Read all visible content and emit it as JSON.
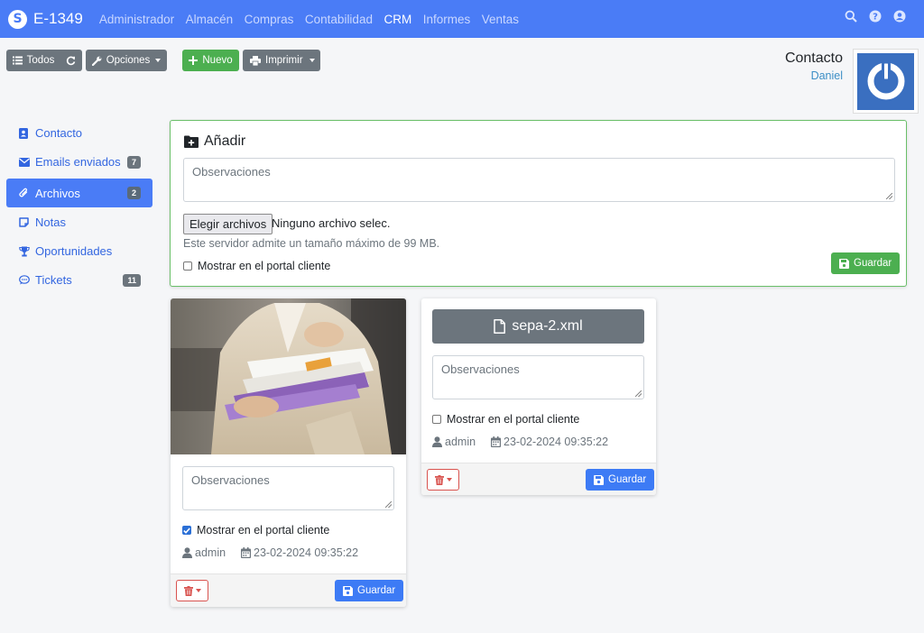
{
  "navbar": {
    "brand": "E-1349",
    "links": [
      "Administrador",
      "Almacén",
      "Compras",
      "Contabilidad",
      "CRM",
      "Informes",
      "Ventas"
    ],
    "active": "CRM",
    "icons": [
      "search-icon",
      "help-icon",
      "user-icon"
    ]
  },
  "toolbar": {
    "todos_label": "Todos",
    "opciones_label": "Opciones",
    "nuevo_label": "Nuevo",
    "imprimir_label": "Imprimir"
  },
  "contact": {
    "title": "Contacto",
    "name": "Daniel"
  },
  "sidebar": {
    "items": [
      {
        "label": "Contacto",
        "badge": "",
        "icon": "address-card-icon"
      },
      {
        "label": "Emails enviados",
        "badge": "7",
        "icon": "envelope-icon"
      },
      {
        "label": "Archivos",
        "badge": "2",
        "icon": "paperclip-icon",
        "active": true
      },
      {
        "label": "Notas",
        "badge": "",
        "icon": "sticky-note-icon"
      },
      {
        "label": "Oportunidades",
        "badge": "",
        "icon": "trophy-icon"
      },
      {
        "label": "Tickets",
        "badge": "11",
        "icon": "comment-dots-icon"
      }
    ]
  },
  "add_panel": {
    "title": "Añadir",
    "observaciones_placeholder": "Observaciones",
    "file_button": "Elegir archivos",
    "file_status": "Ninguno archivo selec.",
    "hint": "Este servidor admite un tamaño máximo de 99 MB.",
    "portal_label": "Mostrar en el portal cliente",
    "portal_checked": false,
    "save_label": "Guardar"
  },
  "files": [
    {
      "kind": "image",
      "observaciones_placeholder": "Observaciones",
      "portal_label": "Mostrar en el portal cliente",
      "portal_checked": true,
      "user": "admin",
      "date": "23-02-2024 09:35:22",
      "save_label": "Guardar"
    },
    {
      "kind": "document",
      "filename": "sepa-2.xml",
      "observaciones_placeholder": "Observaciones",
      "portal_label": "Mostrar en el portal cliente",
      "portal_checked": false,
      "user": "admin",
      "date": "23-02-2024 09:35:22",
      "save_label": "Guardar"
    }
  ],
  "colors": {
    "primary": "#4a7cf6",
    "success": "#4caf50",
    "secondary": "#6c757d",
    "danger": "#d9534f"
  }
}
